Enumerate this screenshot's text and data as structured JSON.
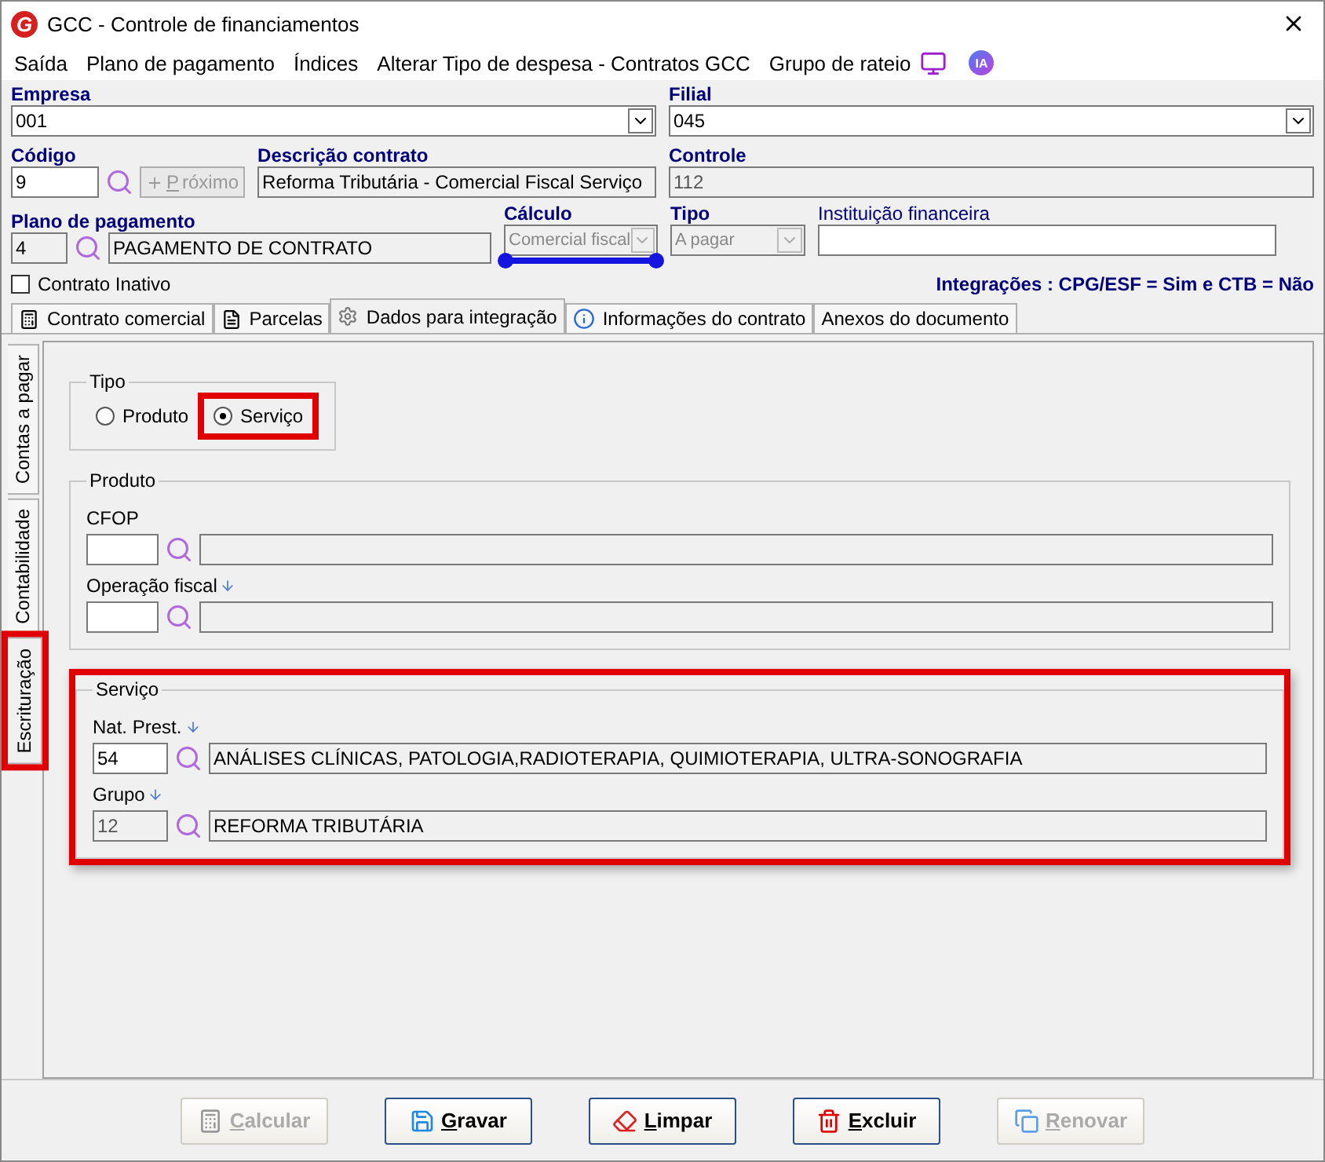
{
  "window": {
    "logo": "G",
    "title": "GCC - Controle de financiamentos"
  },
  "menu": [
    {
      "label": "Saída"
    },
    {
      "label": "Plano de pagamento"
    },
    {
      "label": "Índices"
    },
    {
      "label": "Alterar Tipo de despesa - Contratos GCC"
    },
    {
      "label": "Grupo de rateio"
    }
  ],
  "ia_badge": "IA",
  "empresa": {
    "label": "Empresa",
    "value": "001"
  },
  "filial": {
    "label": "Filial",
    "value": "045"
  },
  "codigo": {
    "label": "Código",
    "value": "9"
  },
  "proximo": {
    "label": "Próximo",
    "disabled": true
  },
  "descricao": {
    "label": "Descrição contrato",
    "value": "Reforma Tributária - Comercial Fiscal Serviço"
  },
  "controle": {
    "label": "Controle",
    "value": "112"
  },
  "plano": {
    "label": "Plano de pagamento",
    "code": "4",
    "description": "PAGAMENTO DE CONTRATO"
  },
  "calculo": {
    "label": "Cálculo",
    "value": "Comercial fiscal",
    "underlined": true
  },
  "tipo": {
    "label": "Tipo",
    "value": "A pagar"
  },
  "instituicao": {
    "label": "Instituição financeira"
  },
  "contrato_inativo": {
    "label": "Contrato Inativo",
    "checked": false
  },
  "integracoes": "Integrações : CPG/ESF = Sim e CTB = Não",
  "tabs": [
    {
      "label": "Contrato comercial",
      "selected": false
    },
    {
      "label": "Parcelas",
      "selected": false
    },
    {
      "label": "Dados para integração",
      "selected": true
    },
    {
      "label": "Informações do contrato",
      "selected": false
    },
    {
      "label": "Anexos do documento",
      "selected": false
    }
  ],
  "side_tabs": [
    {
      "label": "Contas a pagar",
      "selected": false,
      "highlighted": false
    },
    {
      "label": "Contabilidade",
      "selected": false,
      "highlighted": false
    },
    {
      "label": "Escrituração",
      "selected": true,
      "highlighted": true
    }
  ],
  "tipo_group": {
    "title": "Tipo",
    "options": [
      {
        "label": "Produto",
        "selected": false,
        "highlighted": false
      },
      {
        "label": "Serviço",
        "selected": true,
        "highlighted": true
      }
    ]
  },
  "produto_group": {
    "title": "Produto",
    "cfop": {
      "label": "CFOP"
    },
    "operacao": {
      "label": "Operação fiscal"
    }
  },
  "servico_group": {
    "title": "Serviço",
    "highlighted": true,
    "nat": {
      "label": "Nat. Prest.",
      "code": "54",
      "description": "ANÁLISES CLÍNICAS, PATOLOGIA,RADIOTERAPIA, QUIMIOTERAPIA, ULTRA-SONOGRAFIA",
      "disabled": false
    },
    "grupo": {
      "label": "Grupo",
      "code": "12",
      "description": "REFORMA TRIBUTÁRIA",
      "disabled": true
    }
  },
  "buttons": [
    {
      "label": "Calcular",
      "disabled": true
    },
    {
      "label": "Gravar",
      "disabled": false
    },
    {
      "label": "Limpar",
      "disabled": false
    },
    {
      "label": "Excluir",
      "disabled": false
    },
    {
      "label": "Renovar",
      "disabled": true
    }
  ]
}
